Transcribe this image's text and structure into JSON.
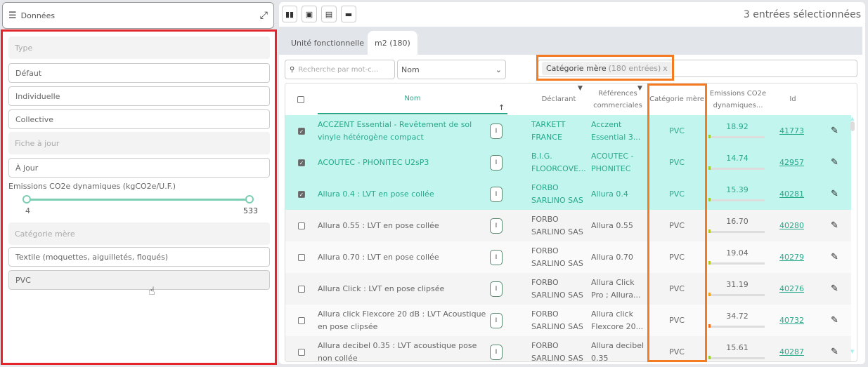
{
  "left": {
    "title": "Données",
    "fields": {
      "type_header": "Type",
      "type_opts": [
        "Défaut",
        "Individuelle",
        "Collective"
      ],
      "fiche_header": "Fiche à jour",
      "fiche_opt": "À jour",
      "emissions_label": "Emissions CO2e dynamiques (kgCO2e/U.F.)",
      "slider_min": "4",
      "slider_max": "533",
      "cat_header": "Catégorie mère",
      "cat_opts": [
        "Textile (moquettes, aiguilletés, floqués)",
        "PVC"
      ]
    }
  },
  "toolbar": {
    "icons": [
      "bar-chart-icon",
      "folder-plus-icon",
      "note-add-icon",
      "trash-icon"
    ],
    "selected_count": "3 entrées sélectionnées"
  },
  "tabs": [
    {
      "label": "Unité fonctionnelle"
    },
    {
      "label": "m2 (180)",
      "active": true
    }
  ],
  "search": {
    "placeholder": "Recherche par mot-c..."
  },
  "sort": {
    "value": "Nom"
  },
  "filter_chip": {
    "label": "Catégorie mère",
    "count": "(180 entrées)",
    "remove": "x"
  },
  "columns": {
    "nom": "Nom",
    "declarant": "Déclarant",
    "refs": "Références commerciales",
    "categorie": "Catégorie mère",
    "emissions": "Emissions CO2e dynamiques...",
    "id": "Id"
  },
  "colors": {
    "accent": "#26a98a",
    "selected_row": "#c2f5ee",
    "highlight": "#f47b20",
    "panel_border": "#e4242b"
  },
  "rows": [
    {
      "selected": true,
      "nom": "ACCZENT Essential - Revêtement de sol vinyle hétérogène compact",
      "badge": "I",
      "declarant": "TARKETT FRANCE",
      "refs": "Acczent Essential 3...",
      "categorie": "PVC",
      "emissions": "18.92",
      "level_color": "#9acd32",
      "id": "41773"
    },
    {
      "selected": true,
      "nom": "ACOUTEC - PHONITEC U2sP3",
      "badge": "I",
      "declarant": "B.I.G. FLOORCOVE...",
      "refs": "ACOUTEC - PHONITEC",
      "categorie": "PVC",
      "emissions": "14.74",
      "level_color": "#9acd32",
      "id": "42957"
    },
    {
      "selected": true,
      "nom": "Allura 0.4 : LVT en pose collée",
      "badge": "I",
      "declarant": "FORBO SARLINO SAS",
      "refs": "Allura 0.4",
      "categorie": "PVC",
      "emissions": "15.39",
      "level_color": "#9acd32",
      "id": "40281"
    },
    {
      "selected": false,
      "nom": "Allura 0.55 : LVT en pose collée",
      "badge": "I",
      "declarant": "FORBO SARLINO SAS",
      "refs": "Allura 0.55",
      "categorie": "PVC",
      "emissions": "16.70",
      "level_color": "#b5c52a",
      "id": "40280"
    },
    {
      "selected": false,
      "nom": "Allura 0.70 : LVT en pose collée",
      "badge": "I",
      "declarant": "FORBO SARLINO SAS",
      "refs": "Allura 0.70",
      "categorie": "PVC",
      "emissions": "19.04",
      "level_color": "#b5c52a",
      "id": "40279"
    },
    {
      "selected": false,
      "nom": "Allura Click : LVT en pose clipsée",
      "badge": "I",
      "declarant": "FORBO SARLINO SAS",
      "refs": "Allura Click Pro ; Allura...",
      "categorie": "PVC",
      "emissions": "31.19",
      "level_color": "#f0a020",
      "id": "40276"
    },
    {
      "selected": false,
      "nom": "Allura click Flexcore 20 dB : LVT Acoustique en pose clipsée",
      "badge": "I",
      "declarant": "FORBO SARLINO SAS",
      "refs": "Allura click Flexcore 20...",
      "categorie": "PVC",
      "emissions": "34.72",
      "level_color": "#f07020",
      "id": "40732"
    },
    {
      "selected": false,
      "nom": "Allura decibel 0.35 : LVT acoustique pose non collée",
      "badge": "I",
      "declarant": "FORBO SARLINO SAS",
      "refs": "Allura decibel 0.35",
      "categorie": "PVC",
      "emissions": "15.61",
      "level_color": "#9acd32",
      "id": "40287"
    }
  ]
}
